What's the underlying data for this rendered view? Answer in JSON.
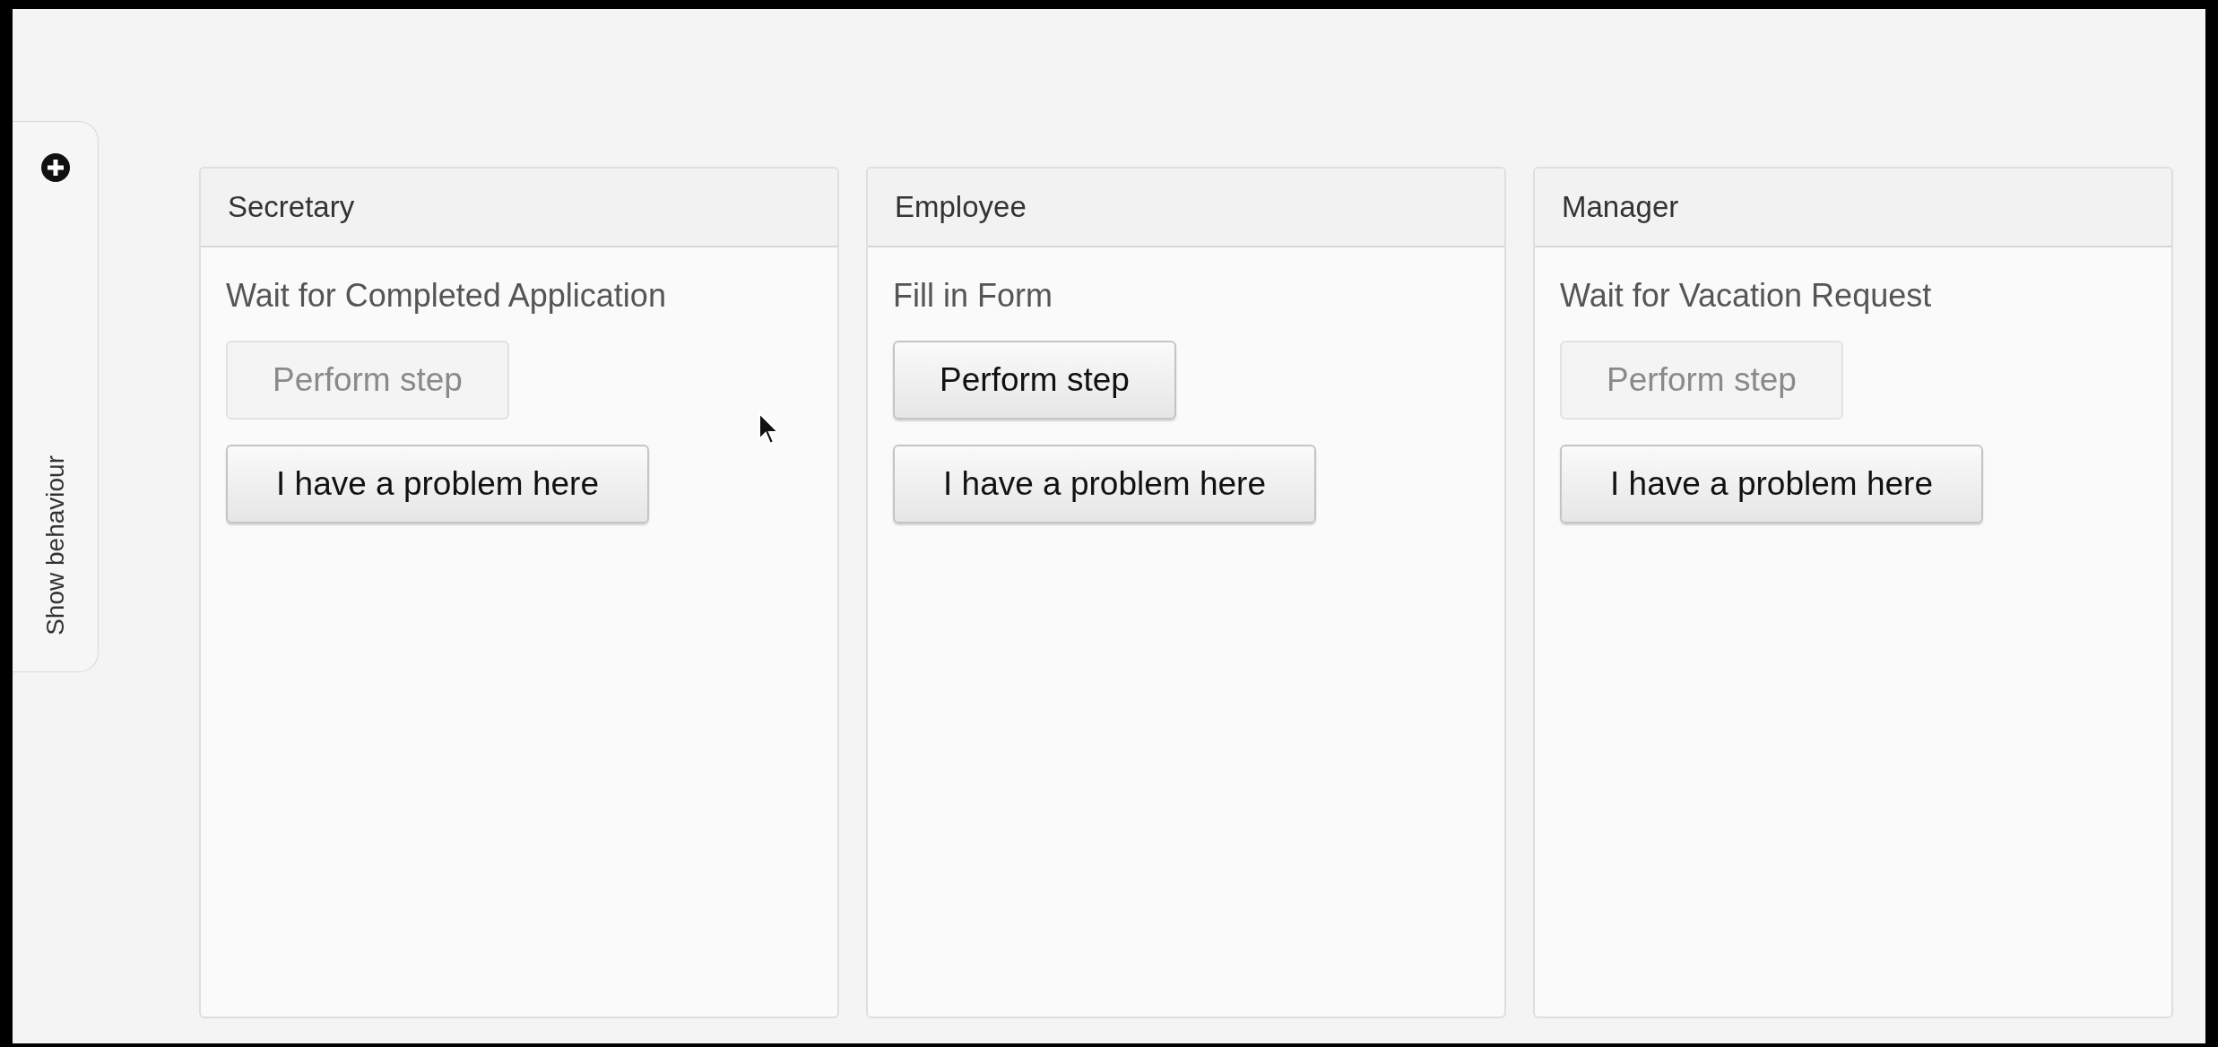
{
  "sidebar": {
    "label": "Show behaviour"
  },
  "lanes": [
    {
      "title": "Secretary",
      "task": "Wait for Completed Application",
      "perform_button": {
        "label": "Perform step",
        "disabled": true
      },
      "problem_button": "I have a problem here"
    },
    {
      "title": "Employee",
      "task": "Fill in Form",
      "perform_button": {
        "label": "Perform step",
        "disabled": false
      },
      "problem_button": "I have a problem here"
    },
    {
      "title": "Manager",
      "task": "Wait for Vacation Request",
      "perform_button": {
        "label": "Perform step",
        "disabled": true
      },
      "problem_button": "I have a problem here"
    }
  ]
}
